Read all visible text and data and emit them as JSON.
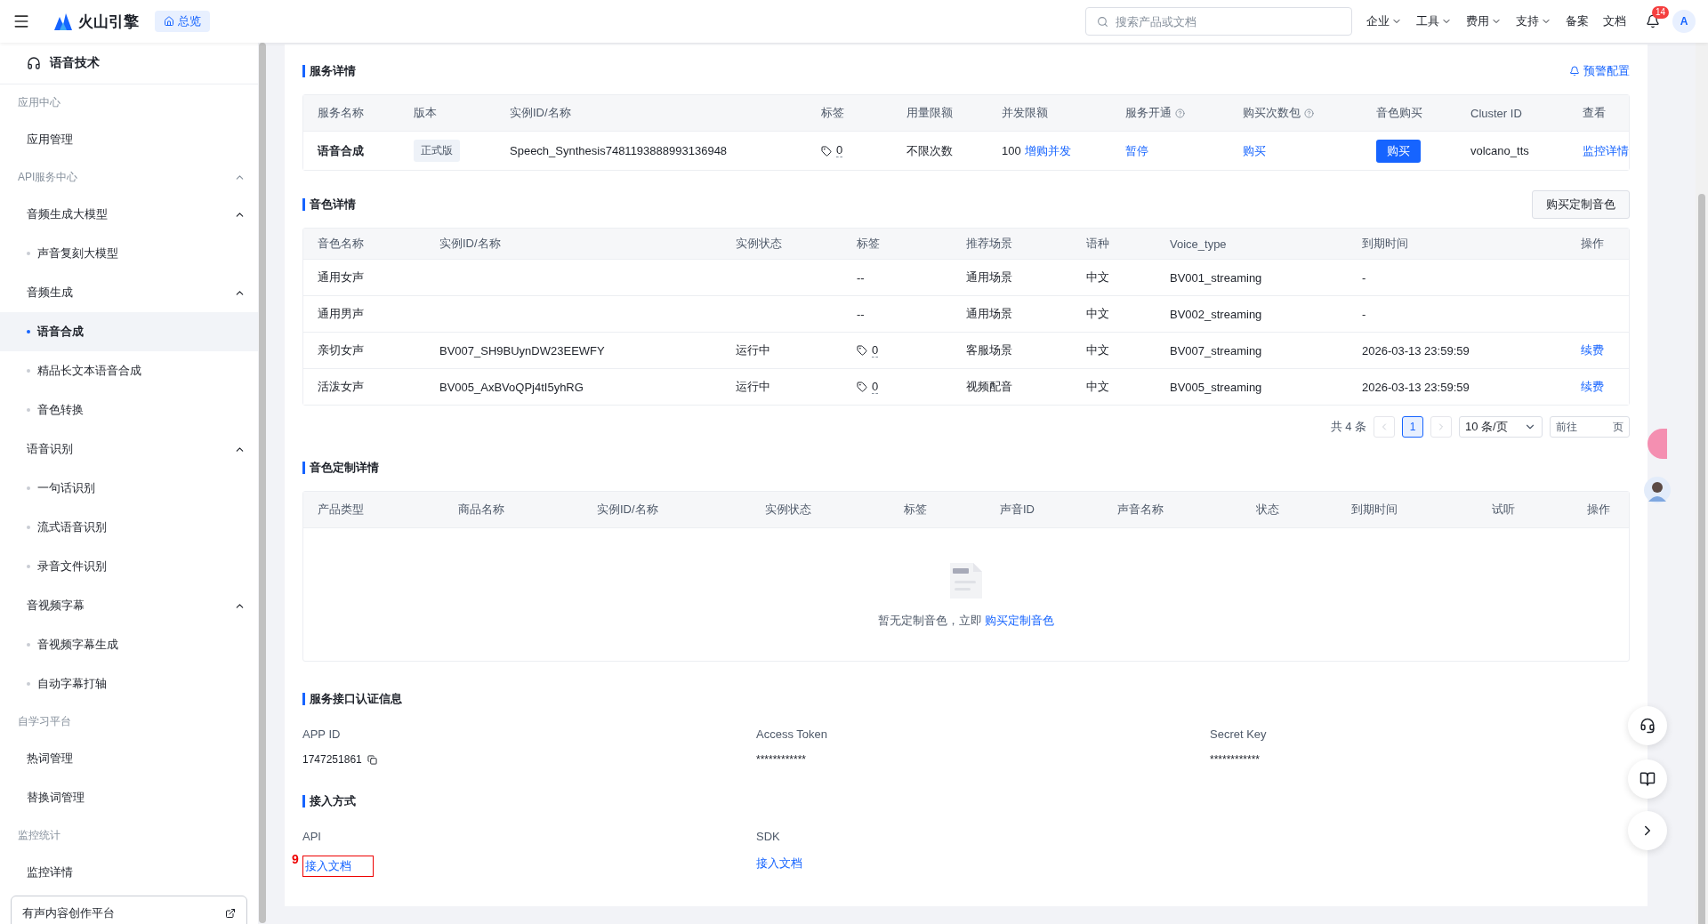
{
  "topbar": {
    "brand": "火山引擎",
    "home_tab": "总览",
    "search": {
      "placeholder": "搜索产品或文档"
    },
    "nav": [
      {
        "label": "企业",
        "dropdown": true
      },
      {
        "label": "工具",
        "dropdown": true
      },
      {
        "label": "费用",
        "dropdown": true
      },
      {
        "label": "支持",
        "dropdown": true
      },
      {
        "label": "备案",
        "dropdown": false
      },
      {
        "label": "文档",
        "dropdown": false
      }
    ],
    "notifications": "14",
    "avatar": "A"
  },
  "sidebar": {
    "title": "语音技术",
    "sections": [
      {
        "label": "应用中心",
        "items": [
          {
            "label": "应用管理",
            "selected": false
          }
        ]
      },
      {
        "label": "API服务中心",
        "expanded": true,
        "items": [
          {
            "label": "音频生成大模型",
            "expanded": true,
            "children": [
              {
                "label": "声音复刻大模型",
                "selected": false
              }
            ]
          },
          {
            "label": "音频生成",
            "expanded": true,
            "children": [
              {
                "label": "语音合成",
                "selected": true
              },
              {
                "label": "精品长文本语音合成",
                "selected": false
              },
              {
                "label": "音色转换",
                "selected": false
              }
            ]
          },
          {
            "label": "语音识别",
            "expanded": true,
            "children": [
              {
                "label": "一句话识别",
                "selected": false
              },
              {
                "label": "流式语音识别",
                "selected": false
              },
              {
                "label": "录音文件识别",
                "selected": false
              }
            ]
          },
          {
            "label": "音视频字幕",
            "expanded": true,
            "children": [
              {
                "label": "音视频字幕生成",
                "selected": false
              },
              {
                "label": "自动字幕打轴",
                "selected": false
              }
            ]
          }
        ]
      },
      {
        "label": "自学习平台",
        "items": [
          {
            "label": "热词管理",
            "selected": false
          },
          {
            "label": "替换词管理",
            "selected": false
          }
        ]
      },
      {
        "label": "监控统计",
        "items": [
          {
            "label": "监控详情",
            "selected": false
          }
        ]
      }
    ],
    "footer_link": "有声内容创作平台"
  },
  "service": {
    "title": "服务详情",
    "alert_link": "预警配置",
    "columns": [
      {
        "label": "服务名称"
      },
      {
        "label": "版本"
      },
      {
        "label": "实例ID/名称"
      },
      {
        "label": "标签"
      },
      {
        "label": "用量限额"
      },
      {
        "label": "并发限额"
      },
      {
        "label": "服务开通",
        "help": true
      },
      {
        "label": "购买次数包",
        "help": true
      },
      {
        "label": "音色购买"
      },
      {
        "label": "Cluster ID"
      },
      {
        "label": "查看"
      }
    ],
    "row": [
      {
        "kind": "strong",
        "text": "语音合成"
      },
      {
        "kind": "badge",
        "text": "正式版"
      },
      {
        "kind": "text",
        "text": "Speech_Synthesis7481193888993136948"
      },
      {
        "kind": "tag",
        "text": "0"
      },
      {
        "kind": "text",
        "text": "不限次数"
      },
      {
        "kind": "text_link",
        "text": "100",
        "link": "增购并发"
      },
      {
        "kind": "link",
        "text": "暂停"
      },
      {
        "kind": "link",
        "text": "购买"
      },
      {
        "kind": "button",
        "text": "购买"
      },
      {
        "kind": "text",
        "text": "volcano_tts"
      },
      {
        "kind": "link",
        "text": "监控详情"
      }
    ]
  },
  "voices": {
    "title": "音色详情",
    "action": "购买定制音色",
    "columns": [
      "音色名称",
      "实例ID/名称",
      "实例状态",
      "标签",
      "推荐场景",
      "语种",
      "Voice_type",
      "到期时间",
      "操作"
    ],
    "rows": [
      [
        {
          "kind": "text",
          "text": "通用女声"
        },
        {
          "kind": "empty"
        },
        {
          "kind": "empty"
        },
        {
          "kind": "text",
          "text": "--"
        },
        {
          "kind": "text",
          "text": "通用场景"
        },
        {
          "kind": "text",
          "text": "中文"
        },
        {
          "kind": "text",
          "text": "BV001_streaming"
        },
        {
          "kind": "text",
          "text": "-"
        },
        {
          "kind": "empty"
        }
      ],
      [
        {
          "kind": "text",
          "text": "通用男声"
        },
        {
          "kind": "empty"
        },
        {
          "kind": "empty"
        },
        {
          "kind": "text",
          "text": "--"
        },
        {
          "kind": "text",
          "text": "通用场景"
        },
        {
          "kind": "text",
          "text": "中文"
        },
        {
          "kind": "text",
          "text": "BV002_streaming"
        },
        {
          "kind": "text",
          "text": "-"
        },
        {
          "kind": "empty"
        }
      ],
      [
        {
          "kind": "text",
          "text": "亲切女声"
        },
        {
          "kind": "text",
          "text": "BV007_SH9BUynDW23EEWFY"
        },
        {
          "kind": "text",
          "text": "运行中"
        },
        {
          "kind": "tag",
          "text": "0"
        },
        {
          "kind": "text",
          "text": "客服场景"
        },
        {
          "kind": "text",
          "text": "中文"
        },
        {
          "kind": "text",
          "text": "BV007_streaming"
        },
        {
          "kind": "text",
          "text": "2026-03-13 23:59:59"
        },
        {
          "kind": "link",
          "text": "续费"
        }
      ],
      [
        {
          "kind": "text",
          "text": "活泼女声"
        },
        {
          "kind": "text",
          "text": "BV005_AxBVoQPj4tI5yhRG"
        },
        {
          "kind": "text",
          "text": "运行中"
        },
        {
          "kind": "tag",
          "text": "0"
        },
        {
          "kind": "text",
          "text": "视频配音"
        },
        {
          "kind": "text",
          "text": "中文"
        },
        {
          "kind": "text",
          "text": "BV005_streaming"
        },
        {
          "kind": "text",
          "text": "2026-03-13 23:59:59"
        },
        {
          "kind": "link",
          "text": "续费"
        }
      ]
    ],
    "pagination": {
      "total": "共 4 条",
      "pages": [
        {
          "label": "1",
          "selected": true
        }
      ],
      "page_size": "10 条/页",
      "goto": "前往",
      "goto_suffix": "页"
    }
  },
  "custom": {
    "title": "音色定制详情",
    "columns": [
      "产品类型",
      "商品名称",
      "实例ID/名称",
      "实例状态",
      "标签",
      "声音ID",
      "声音名称",
      "状态",
      "到期时间",
      "试听",
      "操作"
    ],
    "empty_text": "暂无定制音色，立即",
    "empty_link": "购买定制音色"
  },
  "auth": {
    "title": "服务接口认证信息",
    "fields": [
      {
        "label": "APP ID",
        "value": "1747251861",
        "copy": true
      },
      {
        "label": "Access Token",
        "value": "************",
        "copy": false
      },
      {
        "label": "Secret Key",
        "value": "************",
        "copy": false
      }
    ]
  },
  "access": {
    "title": "接入方式",
    "items": [
      {
        "label": "API",
        "link": "接入文档",
        "marker": "9"
      },
      {
        "label": "SDK",
        "link": "接入文档"
      }
    ]
  }
}
